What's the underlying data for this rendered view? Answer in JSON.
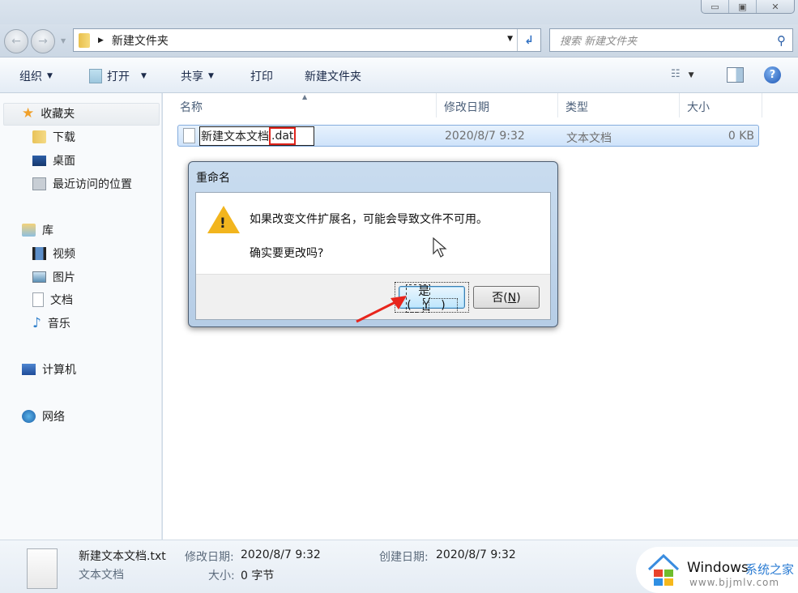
{
  "window": {
    "controls": {
      "minimize": "▭",
      "maximize": "▣",
      "close": "✕"
    }
  },
  "navbar": {
    "back_icon": "back-arrow-icon",
    "forward_icon": "forward-arrow-icon",
    "breadcrumb": [
      "新建文件夹"
    ],
    "search_placeholder": "搜索 新建文件夹"
  },
  "toolbar": {
    "organize": "组织",
    "open": "打开",
    "share": "共享",
    "print": "打印",
    "new_folder": "新建文件夹"
  },
  "sidebar": {
    "favorites": {
      "label": "收藏夹",
      "items": [
        "下载",
        "桌面",
        "最近访问的位置"
      ]
    },
    "libraries": {
      "label": "库",
      "items": [
        "视频",
        "图片",
        "文档",
        "音乐"
      ]
    },
    "computer": "计算机",
    "network": "网络"
  },
  "file_list": {
    "columns": [
      "名称",
      "修改日期",
      "类型",
      "大小"
    ],
    "rows": [
      {
        "name_editing": "新建文本文档",
        "ext_editing": ".dat",
        "modified": "2020/8/7 9:32",
        "type": "文本文档",
        "size": "0 KB"
      }
    ]
  },
  "dialog": {
    "title": "重命名",
    "message": "如果改变文件扩展名，可能会导致文件不可用。",
    "question": "确实要更改吗?",
    "yes_text": "是(",
    "yes_key": "Y",
    "no_text": "否(",
    "no_key": "N",
    "close_paren": ")"
  },
  "details_pane": {
    "filename": "新建文本文档.txt",
    "type": "文本文档",
    "modified_label": "修改日期:",
    "modified_value": "2020/8/7 9:32",
    "created_label": "创建日期:",
    "created_value": "2020/8/7 9:32",
    "size_label": "大小:",
    "size_value": "0 字节"
  },
  "watermark": {
    "brand": "Windows",
    "brand_cn": "系统之家",
    "url": "www.bjjmlv.com"
  },
  "colors": {
    "highlight_red": "#e0241c",
    "selection_blue": "#cfe3fa",
    "link_blue": "#2b7cd3"
  }
}
